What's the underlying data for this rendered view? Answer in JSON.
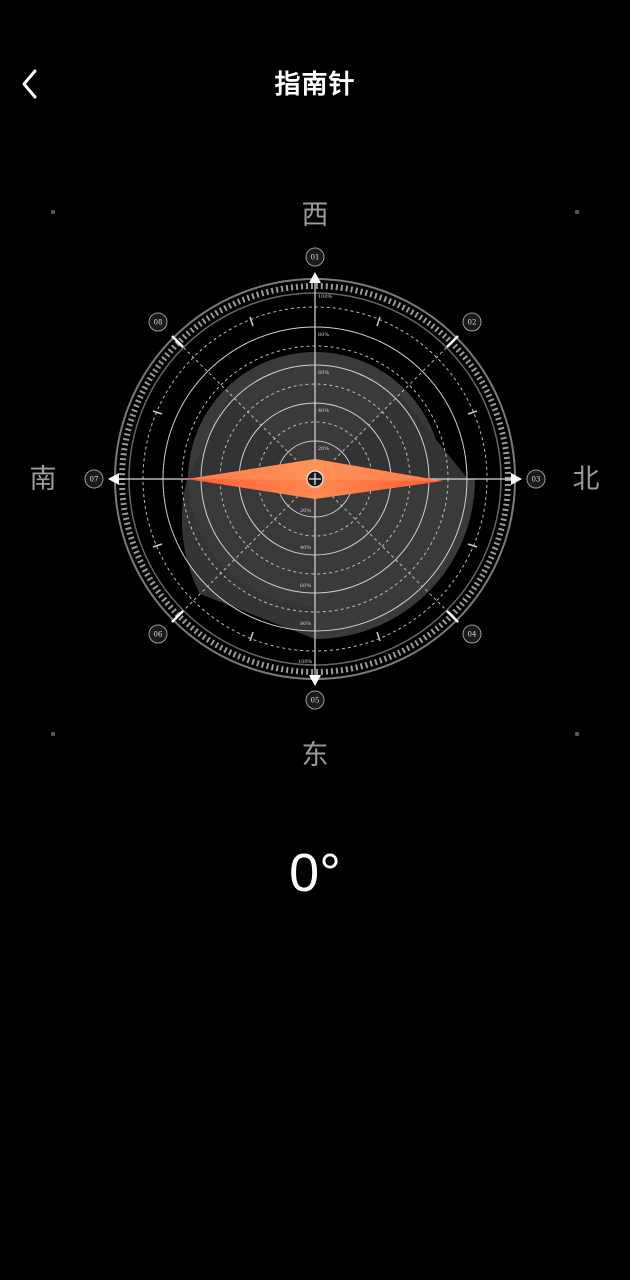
{
  "header": {
    "title": "指南针",
    "back_icon": "chevron-left-icon"
  },
  "directions": {
    "top": "西",
    "left": "南",
    "right": "北",
    "bottom": "东"
  },
  "dial": {
    "markers": [
      "01",
      "02",
      "03",
      "04",
      "05",
      "06",
      "07",
      "08"
    ],
    "percent_labels": [
      "20%",
      "40%",
      "60%",
      "80%",
      "100%"
    ],
    "needle_color": "#ff5a36",
    "needle_color_light": "#ff8a52"
  },
  "heading": {
    "degree": "0°"
  }
}
